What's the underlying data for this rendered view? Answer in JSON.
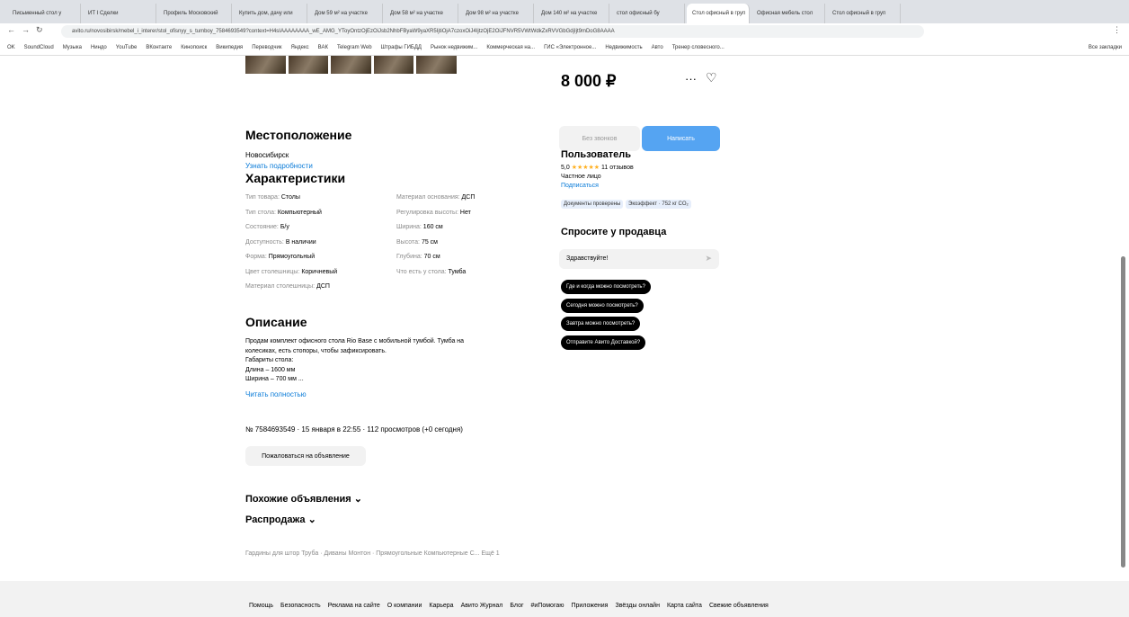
{
  "browser": {
    "tabs": [
      "Письменный стол у",
      "ИТ I Сделки",
      "Профиль Московский",
      "Купить дом, дачу или",
      "Дом 59 м² на участке",
      "Дом 58 м² на участке",
      "Дом 98 м² на участке",
      "Дом 140 м² на участке",
      "стол офисный бу",
      "Стол офисный в груп",
      "Офисная мебель стол",
      "Стол офисный в груп"
    ],
    "url": "avito.ru/novosibirsk/mebel_i_interer/stol_ofisnyy_s_tumboy_7584693549?context=H4sIAAAAAAAA_wE_AMG_YToyOntzOjEzOiJsb2NhbFByaW9yaXR5IjtiOjA7czoxOiJ4IjtzOjE2OiJFNVR5VWtWdkZxRVVGbGdjIjt9mDoG8AAAA",
    "bookmarks": [
      "OK",
      "SoundCloud",
      "Музыка",
      "Ниндо",
      "YouTube",
      "ВКонтакте",
      "Кинопоиск",
      "Википедия",
      "Переводчик",
      "Яндекс",
      "ВАК",
      "Telegram Web",
      "Штрафы ГИБДД",
      "Рынок недвижим...",
      "Коммерческая на...",
      "ГИС «Электронное...",
      "Недвижимость",
      "Авто",
      "Тренер словесного..."
    ],
    "bookmarks_right": "Все закладки"
  },
  "listing": {
    "price": "8 000 ₽",
    "more_icon": "···",
    "fav_icon": "heart-icon",
    "btn_call": "Без звонков",
    "btn_write": "Написать",
    "location_title": "Местоположение",
    "city": "Новосибирск",
    "location_link": "Узнать подробности",
    "specs_title": "Характеристики",
    "specs_left": [
      {
        "k": "Тип товара:",
        "v": "Столы"
      },
      {
        "k": "Тип стола:",
        "v": "Компьютерный"
      },
      {
        "k": "Состояние:",
        "v": "Б/у"
      },
      {
        "k": "Доступность:",
        "v": "В наличии"
      },
      {
        "k": "Форма:",
        "v": "Прямоугольный"
      },
      {
        "k": "Цвет столешницы:",
        "v": "Коричневый"
      },
      {
        "k": "Материал столешницы:",
        "v": "ДСП"
      }
    ],
    "specs_right": [
      {
        "k": "Материал основания:",
        "v": "ДСП"
      },
      {
        "k": "Регулировка высоты:",
        "v": "Нет"
      },
      {
        "k": "Ширина:",
        "v": "160 см"
      },
      {
        "k": "Высота:",
        "v": "75 см"
      },
      {
        "k": "Глубина:",
        "v": "70 см"
      },
      {
        "k": "Что есть у стола:",
        "v": "Тумба"
      }
    ],
    "desc_title": "Описание",
    "desc_lines": [
      "Продам комплект офисного стола Rio Base с мобильной тумбой. Тумба на",
      "колесиках, есть стопоры, чтобы зафиксировать.",
      "Габариты стола:",
      "Длина – 1600 мм",
      "Ширина – 700 мм ..."
    ],
    "read_more": "Читать полностью",
    "meta": "№ 7584693549 · 15 января в 22:55 · 112 просмотров (+0 сегодня)",
    "complain_btn": "Пожаловаться на объявление",
    "similar": "Похожие объявления",
    "sale": "Распродажа",
    "tags": "Гардины для штор Труба · Диваны Монтон · Прямоугольные Компьютерные С... Ещё 1"
  },
  "seller": {
    "name": "Пользователь",
    "rating": "5,0",
    "stars": "★★★★★",
    "reviews": "11 отзывов",
    "type": "Частное лицо",
    "subscribe": "Подписаться",
    "chip1": "Документы проверены",
    "chip2": "Экоэффект · 752 кг CO₂",
    "ask_title": "Спросите у продавца",
    "ask_input": "Здравствуйте!",
    "questions": [
      "Где и когда можно посмотреть?",
      "Сегодня можно посмотреть?",
      "Завтра можно посмотреть?",
      "Отправите Авито Доставкой?"
    ]
  },
  "footer": {
    "links": [
      "Помощь",
      "Безопасность",
      "Реклама на сайте",
      "О компании",
      "Карьера",
      "Авито Журнал",
      "Блог",
      "#иПомогаю",
      "Приложения",
      "Звёзды онлайн",
      "Карта сайта",
      "Свежие объявления"
    ]
  },
  "colors": {
    "accent": "#0a7bd8",
    "button": "#55a4f2"
  }
}
